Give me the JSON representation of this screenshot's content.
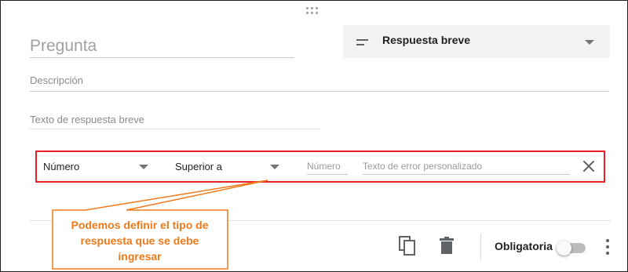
{
  "question": {
    "placeholder": "Pregunta"
  },
  "question_type": {
    "selected": "Respuesta breve",
    "icon": "short-text-icon"
  },
  "description": {
    "placeholder": "Descripción"
  },
  "short_answer_placeholder": "Texto de respuesta breve",
  "validation": {
    "type_selected": "Número",
    "condition_selected": "Superior a",
    "number_placeholder": "Número",
    "error_placeholder": "Texto de error personalizado",
    "highlight_color": "#e8202a"
  },
  "footer": {
    "required_label": "Obligatoria",
    "required_on": false,
    "icons": [
      "duplicate-icon",
      "delete-icon",
      "more-vert-icon"
    ]
  },
  "callout": {
    "text": "Podemos definir el tipo de\nrespuesta que se debe\ningresar",
    "text_color": "#f07a1a",
    "border_color": "#f07a1a"
  }
}
